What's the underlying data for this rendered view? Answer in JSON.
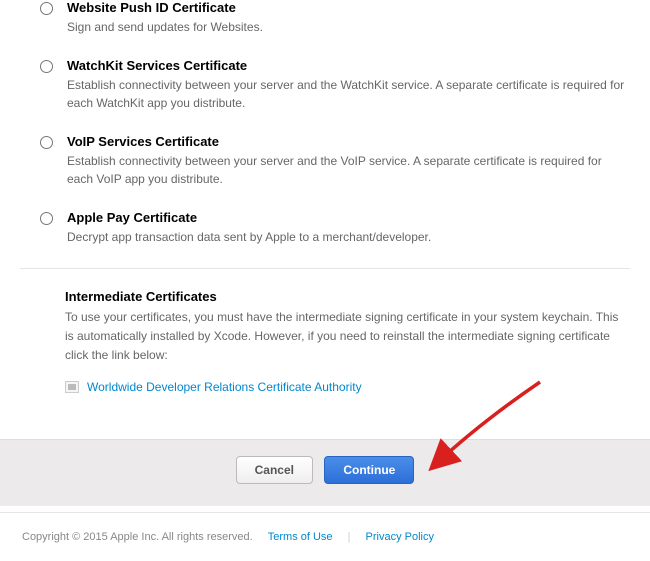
{
  "options": [
    {
      "title": "Website Push ID Certificate",
      "desc": "Sign and send updates for Websites."
    },
    {
      "title": "WatchKit Services Certificate",
      "desc": "Establish connectivity between your server and the WatchKit service. A separate certificate is required for each WatchKit app you distribute."
    },
    {
      "title": "VoIP Services Certificate",
      "desc": "Establish connectivity between your server and the VoIP service. A separate certificate is required for each VoIP app you distribute."
    },
    {
      "title": "Apple Pay Certificate",
      "desc": "Decrypt app transaction data sent by Apple to a merchant/developer."
    }
  ],
  "intermediate": {
    "title": "Intermediate Certificates",
    "desc": "To use your certificates, you must have the intermediate signing certificate in your system keychain. This is automatically installed by Xcode. However, if you need to reinstall the intermediate signing certificate click the link below:",
    "link_label": "Worldwide Developer Relations Certificate Authority"
  },
  "buttons": {
    "cancel": "Cancel",
    "continue": "Continue"
  },
  "footer": {
    "copyright": "Copyright © 2015 Apple Inc. All rights reserved.",
    "terms": "Terms of Use",
    "privacy": "Privacy Policy"
  }
}
